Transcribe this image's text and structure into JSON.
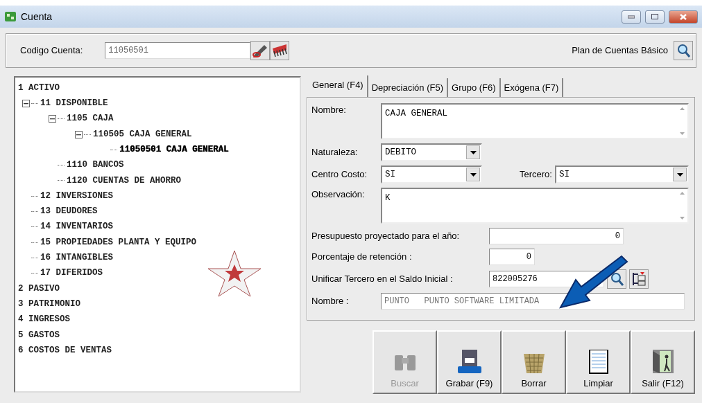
{
  "window": {
    "title": "Cuenta"
  },
  "header": {
    "code_label": "Codigo Cuenta:",
    "code_value": "11050501",
    "plan_label": "Plan de Cuentas Básico"
  },
  "tree": [
    {
      "label": "1 ACTIVO",
      "selected": false,
      "children": [
        {
          "label": "11 DISPONIBLE",
          "selected": false,
          "expanded": true,
          "children": [
            {
              "label": "1105 CAJA",
              "selected": false,
              "expanded": true,
              "children": [
                {
                  "label": "110505 CAJA GENERAL",
                  "selected": false,
                  "expanded": true,
                  "children": [
                    {
                      "label": "11050501 CAJA GENERAL",
                      "selected": true
                    }
                  ]
                }
              ]
            },
            {
              "label": "1110 BANCOS",
              "selected": false
            },
            {
              "label": "1120 CUENTAS DE AHORRO",
              "selected": false
            }
          ]
        },
        {
          "label": "12 INVERSIONES",
          "selected": false
        },
        {
          "label": "13 DEUDORES",
          "selected": false
        },
        {
          "label": "14 INVENTARIOS",
          "selected": false
        },
        {
          "label": "15 PROPIEDADES PLANTA Y EQUIPO",
          "selected": false
        },
        {
          "label": "16 INTANGIBLES",
          "selected": false
        },
        {
          "label": "17 DIFERIDOS",
          "selected": false
        }
      ]
    },
    {
      "label": "2 PASIVO",
      "selected": false
    },
    {
      "label": "3 PATRIMONIO",
      "selected": false
    },
    {
      "label": "4 INGRESOS",
      "selected": false
    },
    {
      "label": "5 GASTOS",
      "selected": false
    },
    {
      "label": "6 COSTOS DE VENTAS",
      "selected": false
    }
  ],
  "tabs": [
    {
      "label": "General (F4)",
      "selected": true
    },
    {
      "label": "Depreciación (F5)",
      "selected": false
    },
    {
      "label": "Grupo (F6)",
      "selected": false
    },
    {
      "label": "Exógena (F7)",
      "selected": false
    }
  ],
  "form": {
    "nombre": {
      "label": "Nombre:",
      "value": "CAJA GENERAL"
    },
    "naturaleza": {
      "label": "Naturaleza:",
      "value": "DEBITO"
    },
    "centro_costo": {
      "label": "Centro Costo:",
      "value": "SI"
    },
    "tercero": {
      "label": "Tercero:",
      "value": "SI"
    },
    "observacion": {
      "label": "Observación:",
      "value": "K"
    },
    "presupuesto": {
      "label": "Presupuesto proyectado para el año:",
      "value": "0"
    },
    "retencion": {
      "label": "Porcentaje de retención :",
      "value": "0"
    },
    "unificar": {
      "label": "Unificar Tercero en el Saldo Inicial :",
      "value": "822005276"
    },
    "nombre_tercero": {
      "label": "Nombre :",
      "value": "PUNTO   PUNTO SOFTWARE LIMITADA"
    }
  },
  "buttons": [
    {
      "label": "Buscar",
      "kind": "search",
      "disabled": true
    },
    {
      "label": "Grabar (F9)",
      "kind": "save",
      "disabled": false
    },
    {
      "label": "Borrar",
      "kind": "delete",
      "disabled": false
    },
    {
      "label": "Limpiar",
      "kind": "clear",
      "disabled": false
    },
    {
      "label": "Salir (F12)",
      "kind": "exit",
      "disabled": false
    }
  ]
}
